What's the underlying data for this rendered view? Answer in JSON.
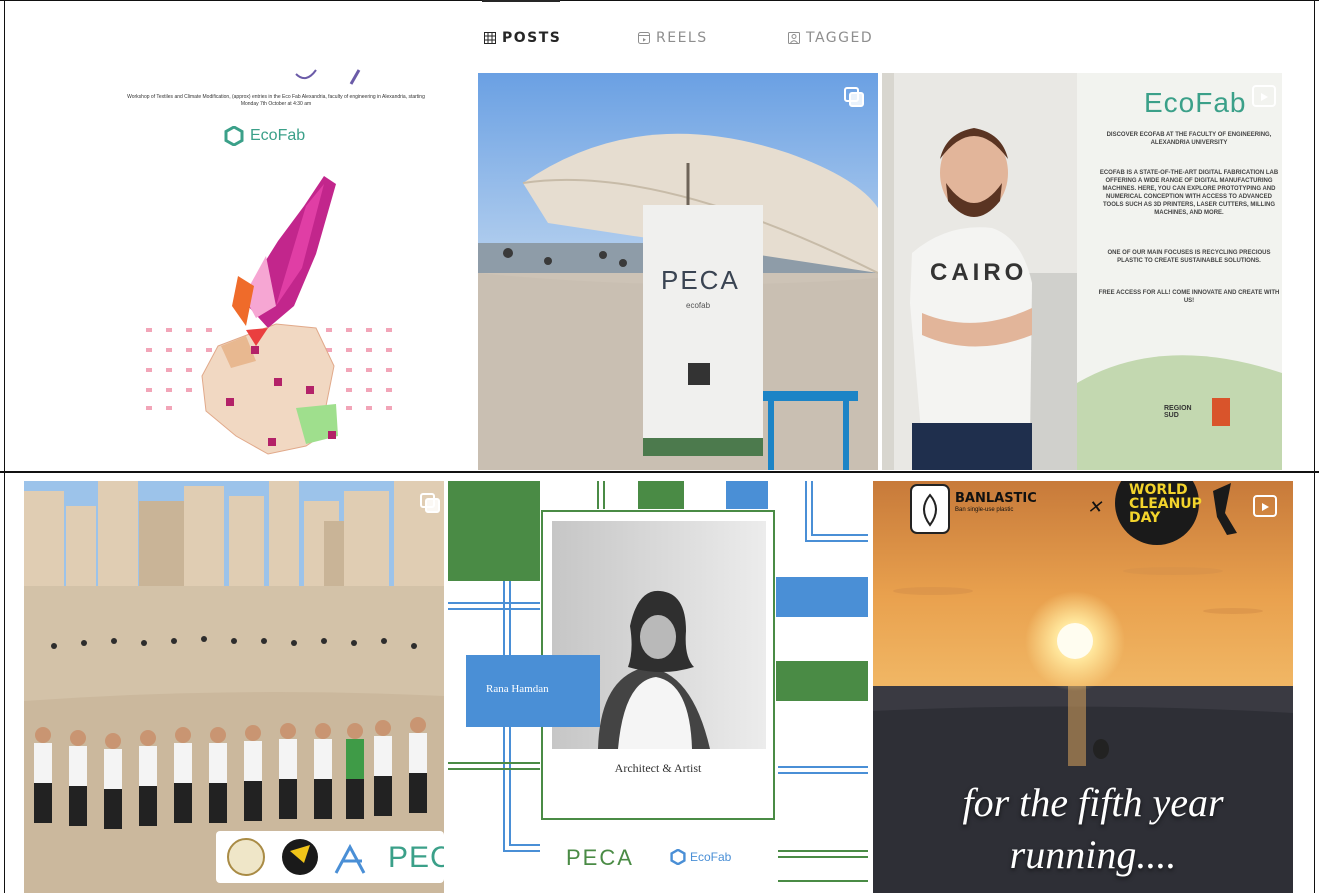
{
  "tabs": [
    {
      "label": "POSTS",
      "icon": "grid-icon",
      "active": true
    },
    {
      "label": "REELS",
      "icon": "reels-icon",
      "active": false
    },
    {
      "label": "TAGGED",
      "icon": "tagged-icon",
      "active": false
    }
  ],
  "posts": {
    "p1": {
      "brand": "EcoFab",
      "caption": "Workshop of Textiles and Climate Modification, (approx) entries in the Eco Fab Alexandria, faculty of engineering in Alexandria, starting Monday 7th October at 4:30 am",
      "icon": "ecofab-logo-icon"
    },
    "p2": {
      "sign": "PECA",
      "sub": "ecofab",
      "icon": "multi-photo-icon"
    },
    "p3": {
      "brand": "EcoFab",
      "shirt": "CAIRO",
      "headline": "DISCOVER ECOFAB AT THE FACULTY OF ENGINEERING, ALEXANDRIA UNIVERSITY",
      "body1": "ECOFAB IS A STATE-OF-THE-ART DIGITAL FABRICATION LAB OFFERING A WIDE RANGE OF DIGITAL MANUFACTURING MACHINES. HERE, YOU CAN EXPLORE PROTOTYPING AND NUMERICAL CONCEPTION WITH ACCESS TO ADVANCED TOOLS SUCH AS 3D PRINTERS, LASER CUTTERS, MILLING MACHINES, AND MORE.",
      "body2": "ONE OF OUR MAIN FOCUSES IS RECYCLING PRECIOUS PLASTIC TO CREATE SUSTAINABLE SOLUTIONS.",
      "body3": "FREE ACCESS FOR ALL! COME INNOVATE AND CREATE WITH US!",
      "sponsor": "REGION SUD",
      "icon": "reel-icon"
    },
    "p4": {
      "sign": "PEC",
      "icon": "multi-photo-icon",
      "badge": "WORLD CLEANUP DAY"
    },
    "p5": {
      "name": "Rana Hamdan",
      "role": "Architect & Artist",
      "logo1": "PECA",
      "logo2": "EcoFab"
    },
    "p6": {
      "brand": "BANLASTIC",
      "brand_sub": "Ban single-use plastic",
      "badge": "WORLD CLEANUP DAY",
      "caption": "for the fifth year running....",
      "icon": "reel-icon"
    }
  },
  "colors": {
    "green": "#4a8b45",
    "blue": "#4a8fd6",
    "ecofab_teal": "#3ba089",
    "magenta": "#c2268c"
  }
}
